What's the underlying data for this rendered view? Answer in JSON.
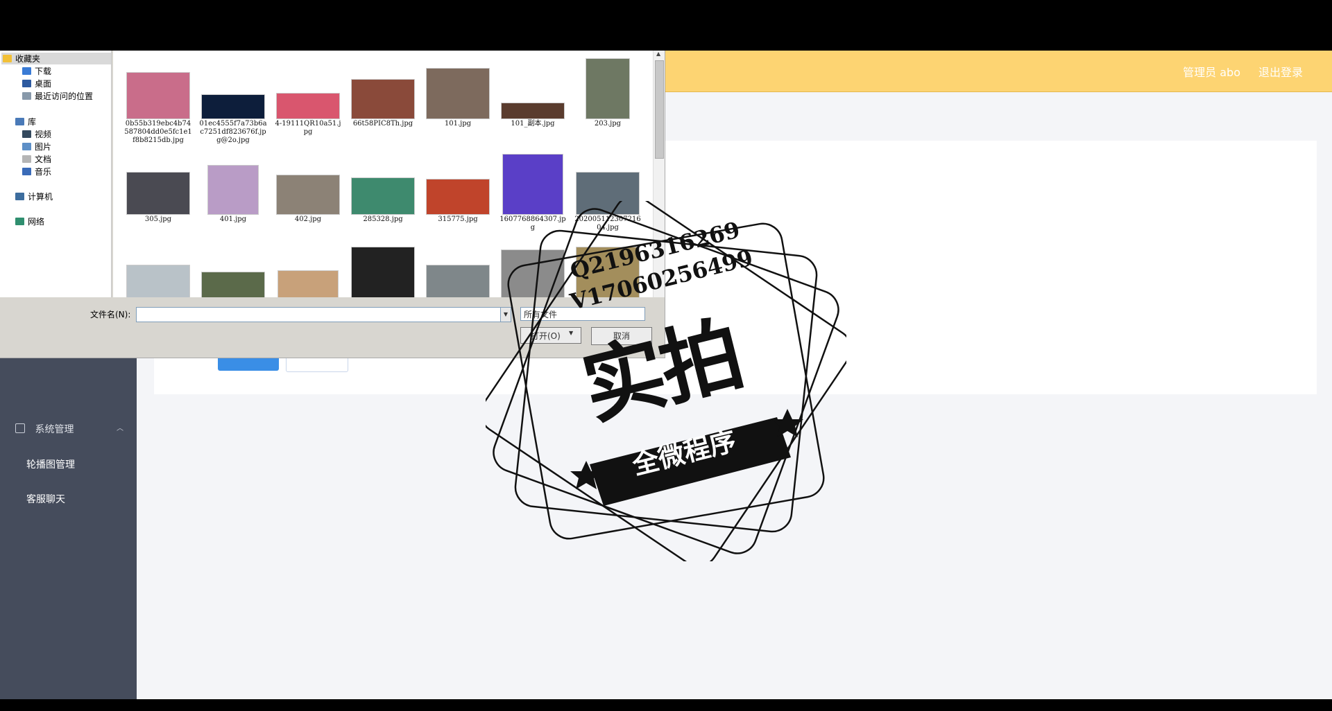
{
  "header": {
    "user_label": "管理员 abo",
    "logout_label": "退出登录"
  },
  "sidebar": {
    "group_label": "系统管理",
    "items": [
      {
        "label": "轮播图管理"
      },
      {
        "label": "客服聊天"
      }
    ]
  },
  "dialog": {
    "tree": [
      {
        "label": "收藏夹",
        "icon": "star-icon",
        "color": "#f2c037"
      },
      {
        "label": "下载",
        "icon": "download-folder-icon",
        "color": "#3a7bd5"
      },
      {
        "label": "桌面",
        "icon": "desktop-icon",
        "color": "#2d5aa0"
      },
      {
        "label": "最近访问的位置",
        "icon": "recent-places-icon",
        "color": "#8899aa"
      },
      {
        "label": "库",
        "icon": "library-icon",
        "color": "#4a7ab8"
      },
      {
        "label": "视频",
        "icon": "video-library-icon",
        "color": "#34495e"
      },
      {
        "label": "图片",
        "icon": "picture-library-icon",
        "color": "#5d8fc7"
      },
      {
        "label": "文档",
        "icon": "document-library-icon",
        "color": "#b5b5b5"
      },
      {
        "label": "音乐",
        "icon": "music-library-icon",
        "color": "#3a6bb8"
      },
      {
        "label": "计算机",
        "icon": "computer-icon",
        "color": "#3d6d9e"
      },
      {
        "label": "网络",
        "icon": "network-icon",
        "color": "#2f8f6f"
      }
    ],
    "files": [
      {
        "name": "0b55b319ebc4b74587804dd0e5fc1e1f8b8215db.jpg",
        "color": "#c96d8a"
      },
      {
        "name": "01ec4555f7a73b6ac7251df823676f.jpg@2o.jpg",
        "color": "#0d1e3b"
      },
      {
        "name": "4-19111QR10a51.jpg",
        "color": "#d9566e"
      },
      {
        "name": "66t58PIC8Th.jpg",
        "color": "#8a4a3a"
      },
      {
        "name": "101.jpg",
        "color": "#7d6a5d"
      },
      {
        "name": "101_副本.jpg",
        "color": "#5a3c2e"
      },
      {
        "name": "203.jpg",
        "color": "#6e7863"
      },
      {
        "name": "305.jpg",
        "color": "#4a4a52"
      },
      {
        "name": "401.jpg",
        "color": "#b99cc6"
      },
      {
        "name": "402.jpg",
        "color": "#8c8276"
      },
      {
        "name": "285328.jpg",
        "color": "#3e8a6e"
      },
      {
        "name": "315775.jpg",
        "color": "#c0442b"
      },
      {
        "name": "1607768864307.jpg",
        "color": "#5a3fc7"
      },
      {
        "name": "20200511230721604.jpg",
        "color": "#5f6d78"
      },
      {
        "name": "",
        "color": "#b9c2c8"
      },
      {
        "name": "",
        "color": "#5b6a4a"
      },
      {
        "name": "",
        "color": "#c8a17a"
      },
      {
        "name": "",
        "color": "#222222"
      },
      {
        "name": "",
        "color": "#7f878a"
      },
      {
        "name": "",
        "color": "#8b8b8b"
      },
      {
        "name": "",
        "color": "#a38e5c"
      }
    ],
    "filename_label": "文件名(N):",
    "filename_value": "",
    "file_type": "所有文件",
    "open_label": "打开(O)",
    "cancel_label": "取消"
  },
  "watermark": {
    "line1": "Q2196316269",
    "line2": "V17060256499",
    "big": "实拍",
    "banner": "全微程序"
  }
}
